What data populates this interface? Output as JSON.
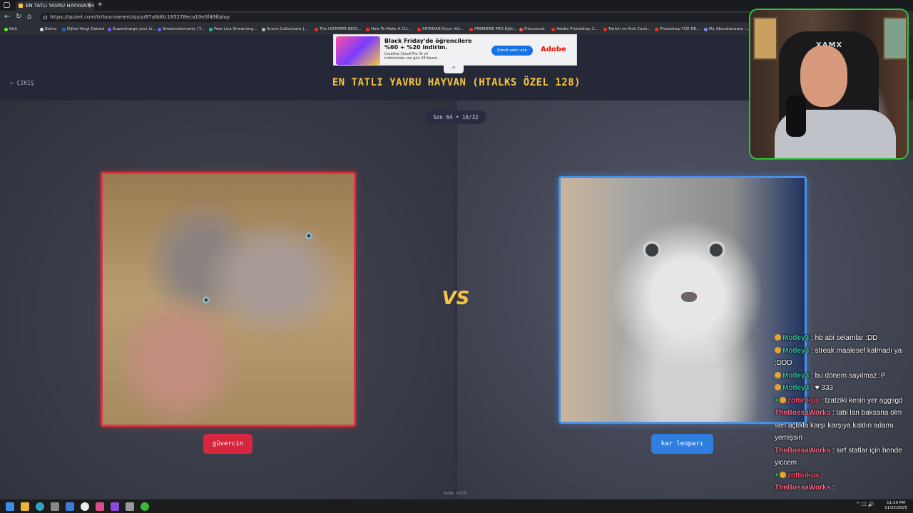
{
  "browser": {
    "tab_title": "EN TATLI YAVRU HAYVAN (HTALKS ÖZEL",
    "tab_close": "✕",
    "new_tab": "+",
    "url": "https://quizel.com/tr/tournament/quiz/67a8d0c185278eca19e0f49f/play",
    "bookmarks": [
      {
        "label": "Kick",
        "color": "#53fc18"
      },
      {
        "label": "Botrix",
        "color": "#e0e0e0"
      },
      {
        "label": "Dijital Vergi Dairesi",
        "color": "#2a62c9"
      },
      {
        "label": "Supercharge your Li...",
        "color": "#7b5cff"
      },
      {
        "label": "Streamelements | T...",
        "color": "#5f6bff"
      },
      {
        "label": "Free Live Streaming...",
        "color": "#25c2a0"
      },
      {
        "label": "Scene Collections |...",
        "color": "#bbbbbb"
      },
      {
        "label": "The ULTIMATE BEGI...",
        "color": "#ff2a2a"
      },
      {
        "label": "How To Make A CU...",
        "color": "#ff2a2a"
      },
      {
        "label": "SIFIRDAN Oyun Vid...",
        "color": "#ff2a2a"
      },
      {
        "label": "PREMIERE PRO Eğiti...",
        "color": "#ff2a2a"
      },
      {
        "label": "Freesound",
        "color": "#ff5a5a"
      },
      {
        "label": "Adobe Photoshop 2...",
        "color": "#ff2a2a"
      },
      {
        "label": "Twitch ve Kick Canlı...",
        "color": "#ff2a2a"
      },
      {
        "label": "Photoshop YÜZ DE...",
        "color": "#ff2a2a"
      },
      {
        "label": "My Abandonware -...",
        "color": "#8888ff"
      }
    ]
  },
  "ad": {
    "headline": "Black Friday'de öğrencilere\n%60 + %20 indirim.",
    "subtext": "Creative Cloud Pro ilk yıl indiriminde son gün 28 Kasım.",
    "cta": "Şimdi satın alın",
    "brand": "Adobe",
    "toggle": "^"
  },
  "page": {
    "exit_label": "← ÇIKIŞ",
    "title": "EN TATLI YAVRU HAYVAN (HTALKS ÖZEL 128)",
    "round": "Son 64 • 16/32",
    "vs": "VS",
    "footer": "made with"
  },
  "choices": {
    "left": {
      "label": "güvercin",
      "color": "#d7263d"
    },
    "right": {
      "label": "kar leoparı",
      "color": "#2f7fe0"
    }
  },
  "webcam": {
    "chair_brand": "XAMX"
  },
  "chat": [
    {
      "user": "Motley3",
      "user_color": "#3cc1a0",
      "text": ": hb abi selamlar :DD",
      "badge": true,
      "plus": false
    },
    {
      "user": "Motley3",
      "user_color": "#3cc1a0",
      "text": ": streak maalesef kalmadı ya :DDD",
      "badge": true,
      "plus": false
    },
    {
      "user": "Motley3",
      "user_color": "#3cc1a0",
      "text": ": bu dönem sayılmaz :P",
      "badge": true,
      "plus": false
    },
    {
      "user": "Motley3",
      "user_color": "#3cc1a0",
      "text": ": ♥ 333",
      "badge": true,
      "plus": false
    },
    {
      "user": "zottirikus",
      "user_color": "#ff4d6d",
      "text": ": tzatziki kesin yer aggsgd",
      "badge": true,
      "plus": true
    },
    {
      "user": "TheBossaWorks",
      "user_color": "#ff6b8a",
      "text": ": tabi lan baksana olm sen açlıkla karşı karşıya kaldın adamı yemişsin",
      "badge": false,
      "plus": false
    },
    {
      "user": "TheBossaWorks",
      "user_color": "#ff6b8a",
      "text": ": sırf statlar için bende yiccem",
      "badge": false,
      "plus": false
    },
    {
      "user": "zottirikus",
      "user_color": "#ff4d6d",
      "text": ":",
      "badge": true,
      "plus": true
    },
    {
      "user": "TheBossaWorks",
      "user_color": "#ff6b8a",
      "text": ":",
      "badge": false,
      "plus": false
    }
  ],
  "taskbar": {
    "time": "11:10 PM",
    "date": "11/22/2025",
    "tray": "^ ☐ 🔊"
  }
}
